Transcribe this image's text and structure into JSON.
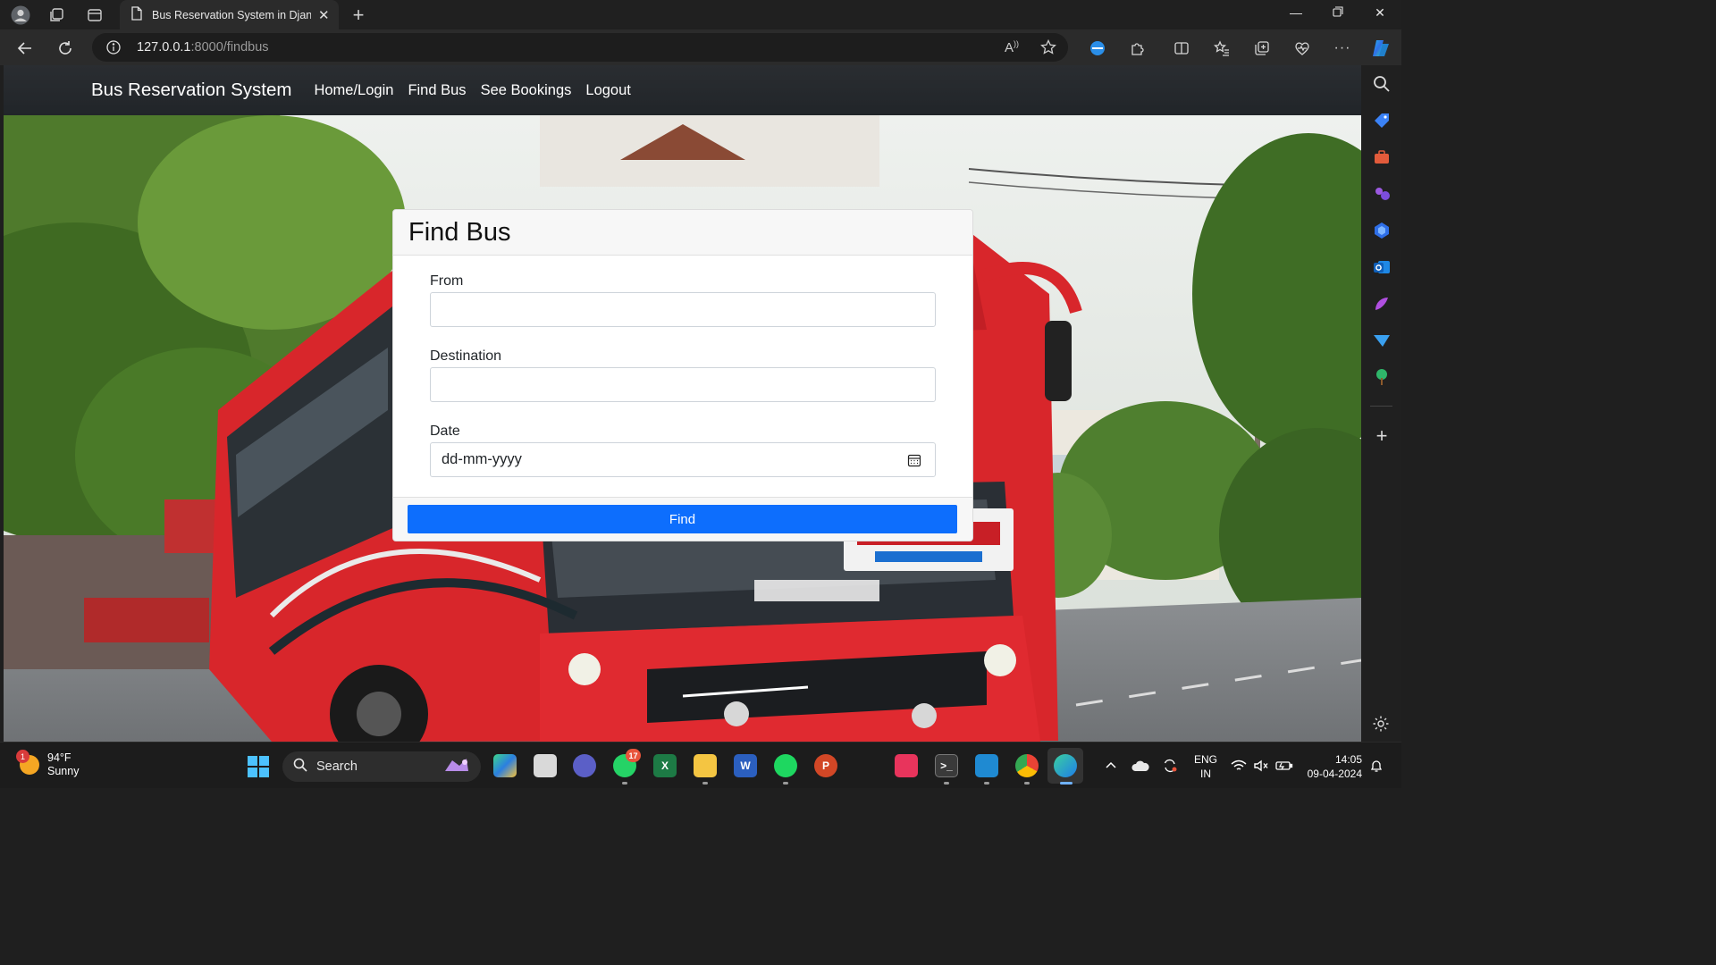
{
  "browser": {
    "tab_title": "Bus Reservation System in Djang",
    "url_host": "127.0.0.1",
    "url_rest": ":8000/findbus",
    "reader_icon_label": "A"
  },
  "site": {
    "brand": "Bus Reservation System",
    "nav": [
      "Home/Login",
      "Find Bus",
      "See Bookings",
      "Logout"
    ]
  },
  "form": {
    "title": "Find Bus",
    "fields": [
      {
        "label": "From",
        "value": ""
      },
      {
        "label": "Destination",
        "value": ""
      },
      {
        "label": "Date",
        "value": "dd-mm-yyyy"
      }
    ],
    "submit_label": "Find"
  },
  "taskbar": {
    "weather_temp": "94°F",
    "weather_desc": "Sunny",
    "weather_badge": "1",
    "search_label": "Search",
    "whatsapp_badge": "17",
    "lang_top": "ENG",
    "lang_bottom": "IN",
    "time": "14:05",
    "date": "09-04-2024"
  },
  "colors": {
    "accent": "#0d6efd",
    "navbar": "#212529"
  }
}
